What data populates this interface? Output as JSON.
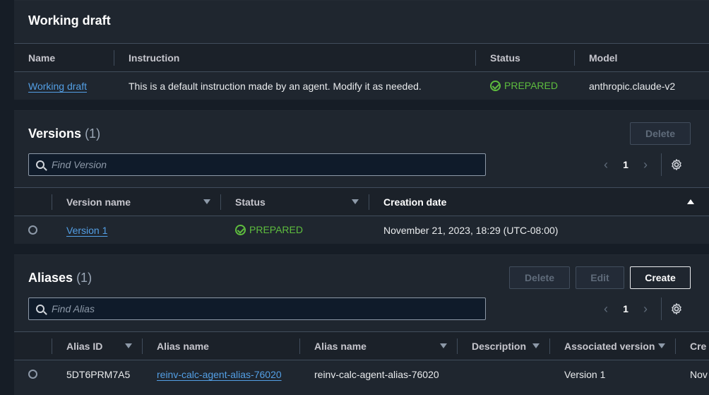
{
  "working_draft": {
    "title": "Working draft",
    "columns": [
      "Name",
      "Instruction",
      "Status",
      "Model"
    ],
    "row": {
      "name": "Working draft",
      "instruction": "This is a default instruction made by an agent. Modify it as needed.",
      "status": "PREPARED",
      "model": "anthropic.claude-v2"
    }
  },
  "versions": {
    "title": "Versions",
    "count": "(1)",
    "delete_label": "Delete",
    "search_placeholder": "Find Version",
    "page": "1",
    "columns": [
      "Version name",
      "Status",
      "Creation date"
    ],
    "rows": [
      {
        "name": "Version 1",
        "status": "PREPARED",
        "created": "November 21, 2023, 18:29 (UTC-08:00)"
      }
    ]
  },
  "aliases": {
    "title": "Aliases",
    "count": "(1)",
    "delete_label": "Delete",
    "edit_label": "Edit",
    "create_label": "Create",
    "search_placeholder": "Find Alias",
    "page": "1",
    "columns": [
      "Alias ID",
      "Alias name",
      "Alias name",
      "Description",
      "Associated version",
      "Cre"
    ],
    "rows": [
      {
        "id": "5DT6PRM7A5",
        "alias_link": "reinv-calc-agent-alias-76020",
        "alias_name": "reinv-calc-agent-alias-76020",
        "description": "",
        "version": "Version 1",
        "created": "Nov"
      }
    ]
  },
  "colors": {
    "background": "#161d26",
    "panel": "#1f262f",
    "link": "#539fe5",
    "success": "#5ebd3e"
  }
}
